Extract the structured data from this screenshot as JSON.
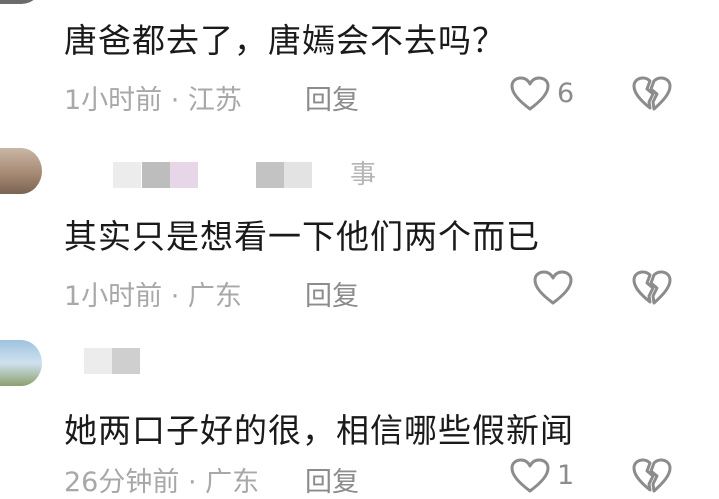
{
  "comments": [
    {
      "text": "唐爸都去了，唐嫣会不去吗？",
      "meta": "1小时前 · 江苏",
      "reply_label": "回复",
      "like_count": "6"
    },
    {
      "name_suffix": "事",
      "text": "其实只是想看一下他们两个而已",
      "meta": "1小时前 · 广东",
      "reply_label": "回复",
      "like_count": ""
    },
    {
      "text": "她两口子好的很，相信哪些假新闻",
      "meta": "26分钟前 · 广东",
      "reply_label": "回复",
      "like_count": "1"
    }
  ],
  "icons": {
    "like": "heart-outline-icon",
    "dislike": "broken-heart-icon"
  },
  "colors": {
    "text": "#1a1a1a",
    "meta": "#a8a8a8",
    "action": "#8c8c8c",
    "background": "#ffffff"
  }
}
